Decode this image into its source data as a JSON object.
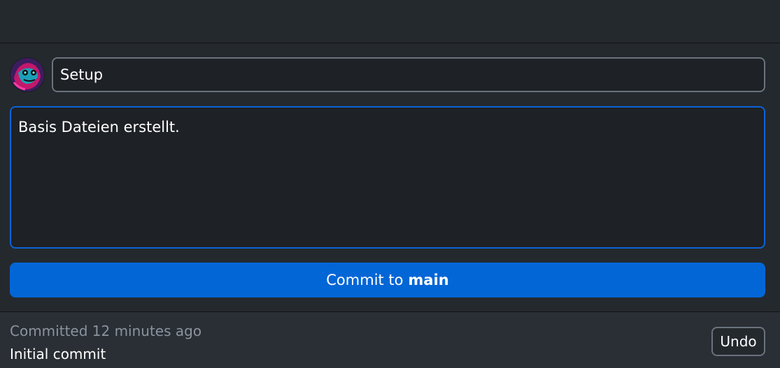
{
  "commit_form": {
    "summary_value": "Setup",
    "description_value": "Basis Dateien erstellt.",
    "commit_button": {
      "prefix": "Commit to",
      "branch": "main"
    }
  },
  "last_commit": {
    "time_text": "Committed 12 minutes ago",
    "summary": "Initial commit",
    "undo_label": "Undo"
  },
  "colors": {
    "background": "#24292e",
    "input_background": "#1e2125",
    "accent": "#0366d6",
    "focus_border": "#0b63d6",
    "muted_text": "#8b949e"
  }
}
